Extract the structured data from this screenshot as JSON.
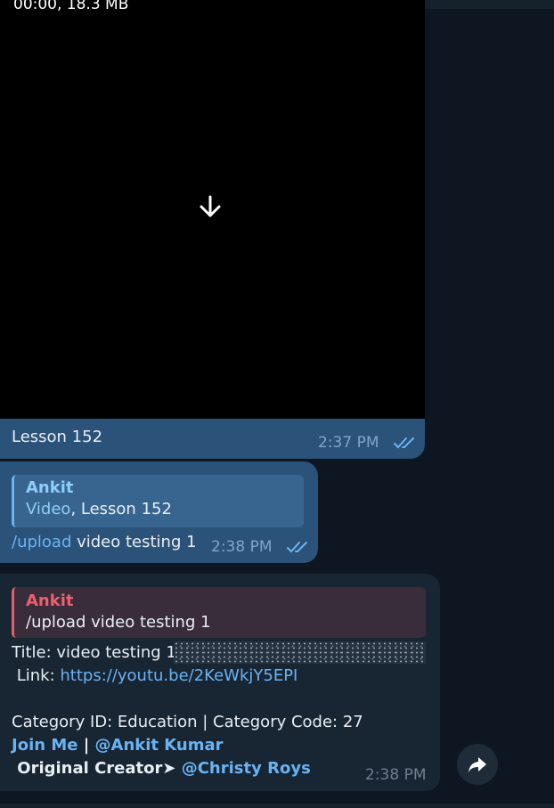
{
  "video_message": {
    "meta": "00:00, 18.3 MB",
    "download_icon": "arrow-down-icon",
    "caption": "Lesson 152",
    "time": "2:37 PM",
    "status_icon": "double-check-icon"
  },
  "reply_message": {
    "quote_author": "Ankit",
    "quote_link": "Video",
    "quote_rest": ", Lesson 152",
    "command": "/upload",
    "text_rest": " video testing 1",
    "time": "2:38 PM",
    "status_icon": "double-check-icon"
  },
  "incoming_message": {
    "quote_author": "Ankit",
    "quote_text": "/upload video testing 1",
    "title_line": "Title: video testing 1",
    "link_label": " Link: ",
    "link_url": "https://youtu.be/2KeWkjY5EPI",
    "category_line": "Category ID: Education | Category Code: 27",
    "join_label": "Join Me",
    "separator": " | ",
    "author_link": "@Ankit Kumar",
    "creator_label": " Original Creator➤ ",
    "creator_link": "@Christy Roys",
    "time": "2:38 PM"
  },
  "share_button": {
    "icon": "share-forward-icon"
  },
  "colors": {
    "background": "#0e1621",
    "outgoing_bubble": "#2b5278",
    "incoming_bubble": "#182533",
    "link": "#6ab3f3",
    "reply_accent_red": "#e35e6a"
  }
}
